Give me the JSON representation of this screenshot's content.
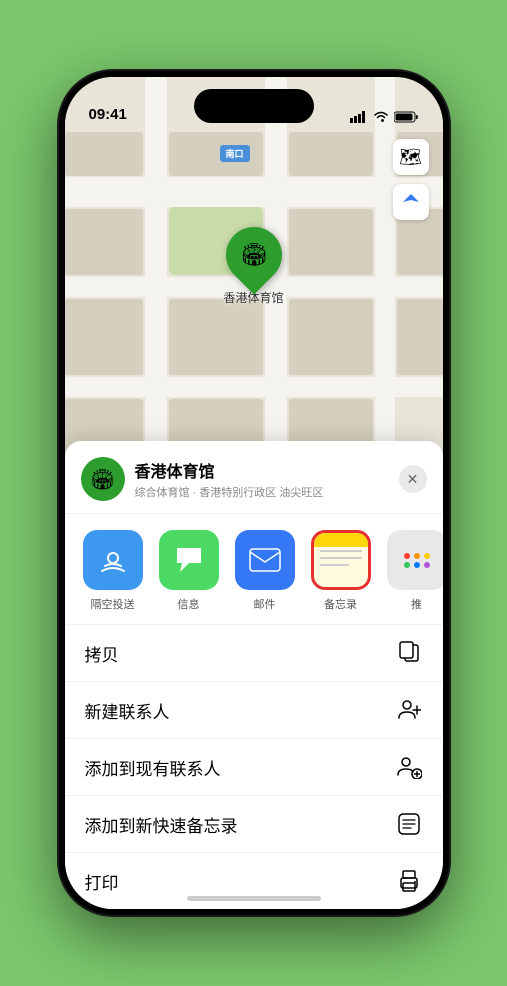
{
  "status_bar": {
    "time": "09:41",
    "location_arrow": true
  },
  "map": {
    "label": "南口",
    "controls": {
      "map_icon": "🗺",
      "location_icon": "➤"
    },
    "pin_label": "香港体育馆",
    "pin_emoji": "🏟"
  },
  "sheet": {
    "venue_name": "香港体育馆",
    "venue_subtitle": "综合体育馆 · 香港特别行政区 油尖旺区",
    "close_label": "✕",
    "share_items": [
      {
        "id": "airdrop",
        "label": "隔空投送",
        "emoji": "📡"
      },
      {
        "id": "messages",
        "label": "信息",
        "emoji": "💬"
      },
      {
        "id": "mail",
        "label": "邮件",
        "emoji": "✉️"
      },
      {
        "id": "notes",
        "label": "备忘录",
        "emoji": ""
      },
      {
        "id": "more",
        "label": "推",
        "emoji": "···"
      }
    ],
    "actions": [
      {
        "id": "copy",
        "label": "拷贝",
        "icon": "copy"
      },
      {
        "id": "new-contact",
        "label": "新建联系人",
        "icon": "person-plus"
      },
      {
        "id": "add-existing",
        "label": "添加到现有联系人",
        "icon": "person-badge-plus"
      },
      {
        "id": "add-notes",
        "label": "添加到新快速备忘录",
        "icon": "notes-square"
      },
      {
        "id": "print",
        "label": "打印",
        "icon": "printer"
      }
    ]
  }
}
